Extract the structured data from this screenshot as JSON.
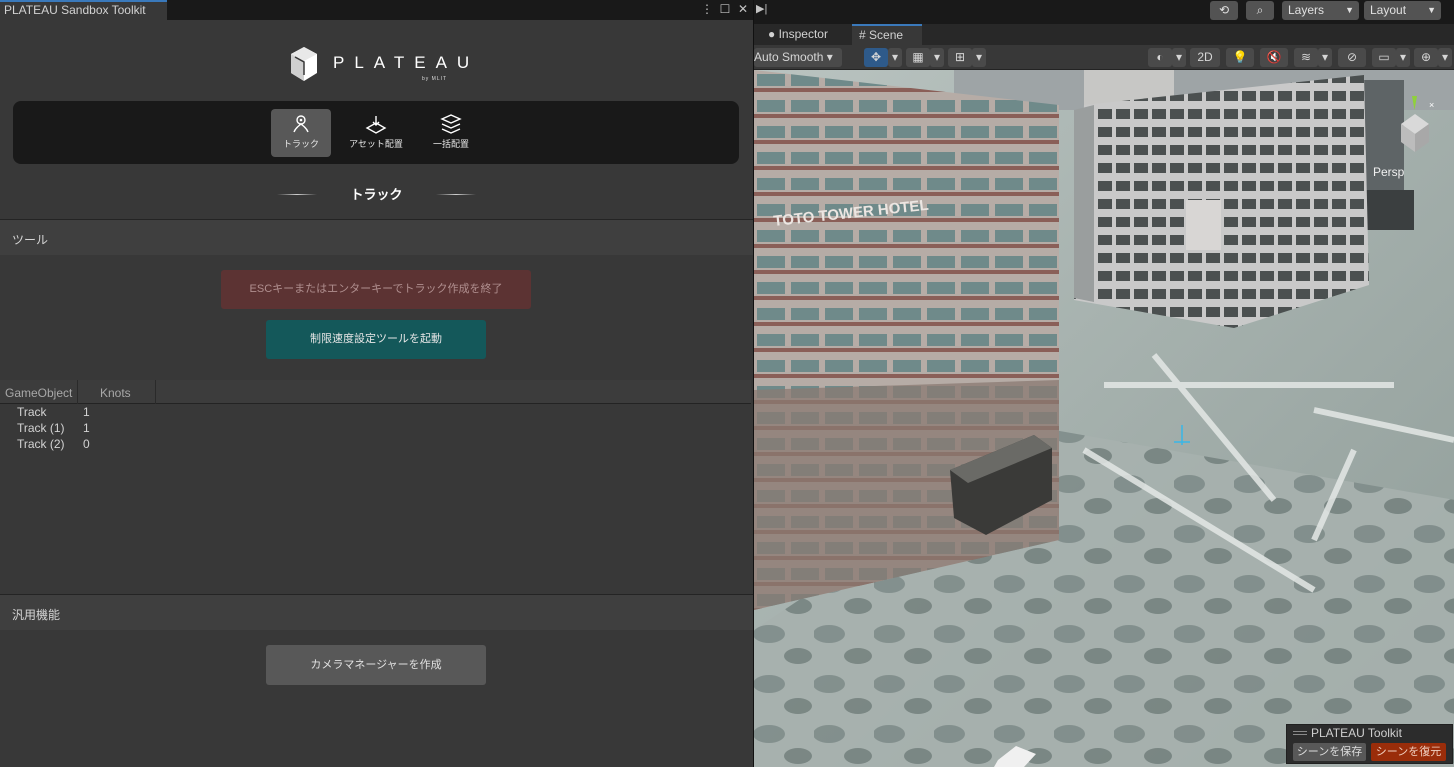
{
  "left_panel": {
    "tab_title": "PLATEAU Sandbox Toolkit",
    "window_icons": [
      "⋮",
      "☐",
      "✕"
    ],
    "logo": {
      "word": "PLATEAU",
      "by": "by MLIT"
    },
    "modes": [
      {
        "label": "トラック",
        "icon": "track-icon",
        "active": true
      },
      {
        "label": "アセット配置",
        "icon": "asset-place-icon",
        "active": false
      },
      {
        "label": "一括配置",
        "icon": "bulk-place-icon",
        "active": false
      }
    ],
    "section_title": "トラック",
    "tools": {
      "header": "ツール",
      "esc_button": "ESCキーまたはエンターキーでトラック作成を終了",
      "speed_button": "制限速度設定ツールを起動"
    },
    "table": {
      "columns": [
        "GameObject",
        "Knots"
      ],
      "rows": [
        {
          "name": "Track",
          "knots": "1"
        },
        {
          "name": "Track (1)",
          "knots": "1"
        },
        {
          "name": "Track (2)",
          "knots": "0"
        }
      ]
    },
    "general": {
      "header": "汎用機能",
      "camera_button": "カメラマネージャーを作成"
    }
  },
  "right_panel": {
    "top": {
      "layers": "Layers",
      "layout": "Layout"
    },
    "tabs": [
      {
        "label": "Inspector",
        "icon": "info-icon"
      },
      {
        "label": "Scene",
        "icon": "scene-grid-icon",
        "active": true
      }
    ],
    "toolbar": {
      "shading": "Auto Smooth",
      "mode_2d": "2D"
    },
    "viewport": {
      "building_sign": "TOTO TOWER HOTEL",
      "gizmo_label": "Persp"
    },
    "overlay": {
      "title": "PLATEAU Toolkit",
      "save": "シーンを保存",
      "restore": "シーンを復元"
    }
  }
}
